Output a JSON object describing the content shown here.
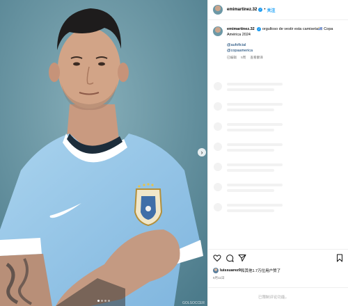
{
  "post": {
    "username": "emimartinez.32",
    "separator": "•",
    "follow_label": "关注",
    "caption_text": "orgulloso de vestir esta camiseta🇺🇾 Copa América 2024",
    "mentions": [
      "@aufoficial",
      "@copaamerica"
    ],
    "meta": {
      "edited": "已编辑",
      "time": "5周",
      "translate": "查看翻译"
    },
    "liked_by_user": "luissuarez9",
    "liked_by_suffix": "和其他1.7万位用户赞了",
    "date": "6月11日",
    "comment_placeholder": "已限制评论功能。",
    "media": {
      "image_count": 4,
      "current_index": 0,
      "watermark": "GOLSOCCER"
    },
    "verified_color": "#1d9bf0",
    "accent_color": "#0095f6"
  },
  "icons": [
    "heart-icon",
    "comment-icon",
    "share-icon",
    "bookmark-icon",
    "verified-icon",
    "chevron-right-icon"
  ]
}
